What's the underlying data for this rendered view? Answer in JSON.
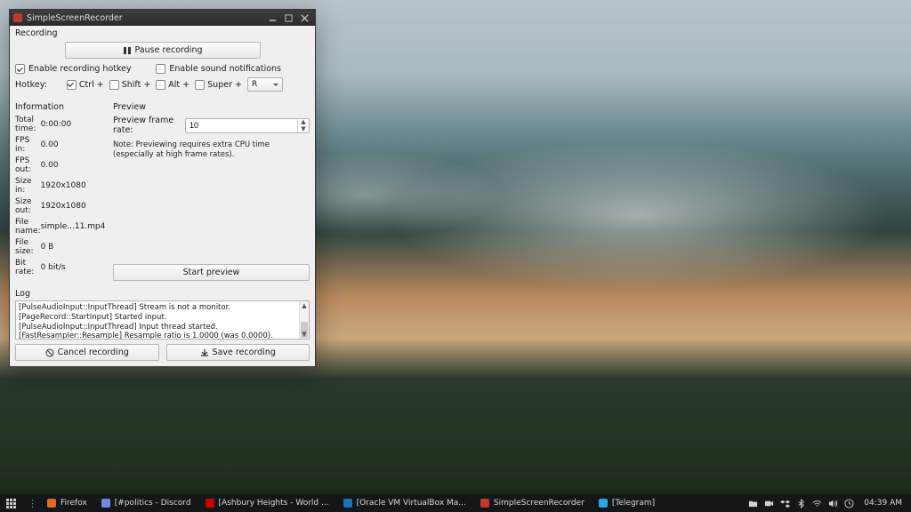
{
  "window": {
    "title": "SimpleScreenRecorder",
    "recording_label": "Recording",
    "pause_label": "Pause recording",
    "enable_hotkey": "Enable recording hotkey",
    "enable_sound": "Enable sound notifications",
    "hotkey_label": "Hotkey:",
    "ctrl": "Ctrl +",
    "shift": "Shift +",
    "alt": "Alt +",
    "super": "Super +",
    "hotkey_key": "R",
    "information_label": "Information",
    "preview_label": "Preview",
    "info": {
      "total_time_l": "Total time:",
      "total_time_v": "0:00:00",
      "fps_in_l": "FPS in:",
      "fps_in_v": "0.00",
      "fps_out_l": "FPS out:",
      "fps_out_v": "0.00",
      "size_in_l": "Size in:",
      "size_in_v": "1920x1080",
      "size_out_l": "Size out:",
      "size_out_v": "1920x1080",
      "file_name_l": "File name:",
      "file_name_v": "simple...11.mp4",
      "file_size_l": "File size:",
      "file_size_v": "0 B",
      "bit_rate_l": "Bit rate:",
      "bit_rate_v": "0 bit/s"
    },
    "preview_fr_label": "Preview frame rate:",
    "preview_fr_value": "10",
    "preview_note": "Note: Previewing requires extra CPU time (especially at high frame rates).",
    "start_preview": "Start preview",
    "log_label": "Log",
    "log": {
      "l1": "[PulseAudioInput::InputThread] Stream is not a monitor.",
      "l2": "[PageRecord::StartInput] Started input.",
      "l3": "[PulseAudioInput::InputThread] Input thread started.",
      "l4": "[FastResampler::Resample] Resample ratio is 1.0000 (was 0.0000)."
    },
    "cancel_label": "Cancel recording",
    "save_label": "Save recording"
  },
  "taskbar": {
    "items": [
      {
        "label": "Firefox"
      },
      {
        "label": "[#politics - Discord"
      },
      {
        "label": "[Ashbury Heights - World ..."
      },
      {
        "label": "[Oracle VM VirtualBox Ma..."
      },
      {
        "label": "SimpleScreenRecorder"
      },
      {
        "label": "[Telegram]"
      }
    ],
    "clock": "04:39 AM"
  }
}
